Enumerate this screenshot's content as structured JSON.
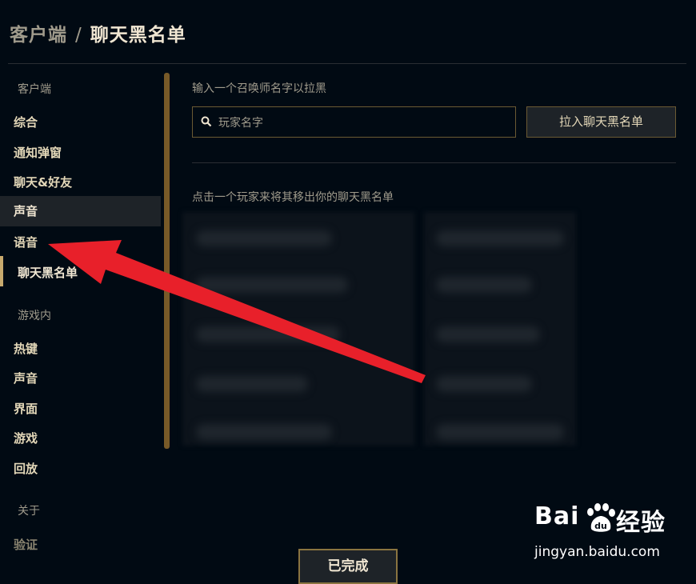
{
  "header": {
    "crumb": "客户端",
    "separator": "/",
    "title": "聊天黑名单"
  },
  "sidebar": {
    "sections": [
      {
        "label": "客户端"
      },
      {
        "label": "游戏内"
      },
      {
        "label": "关于"
      }
    ],
    "client_items": [
      "综合",
      "通知弹窗",
      "聊天&好友",
      "声音",
      "语音"
    ],
    "client_sub_item": "聊天黑名单",
    "game_items": [
      "热键",
      "声音",
      "界面",
      "游戏",
      "回放"
    ],
    "about_items": [
      "验证"
    ]
  },
  "main": {
    "prompt": "输入一个召唤师名字以拉黑",
    "search_placeholder": "玩家名字",
    "block_button": "拉入聊天黑名单",
    "remove_hint": "点击一个玩家来将其移出你的聊天黑名单"
  },
  "footer": {
    "done_button": "已完成"
  },
  "watermark": {
    "brand_left": "Bai",
    "brand_right": "经验",
    "url": "jingyan.baidu.com"
  },
  "colors": {
    "background": "#010a13",
    "gold": "#c8aa6e",
    "arrow": "#e8202a"
  }
}
